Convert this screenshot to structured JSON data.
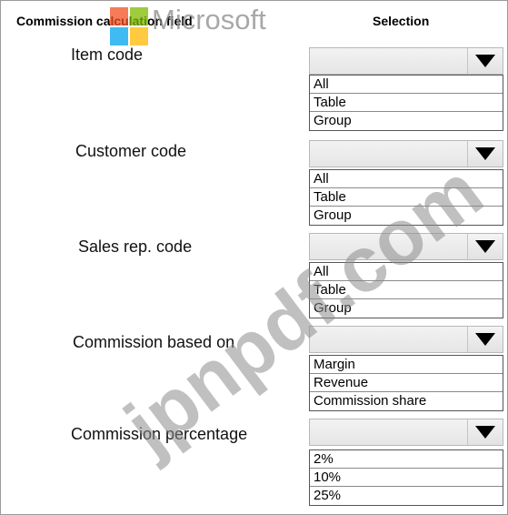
{
  "header": {
    "field_label": "Commission calculation field",
    "selection_label": "Selection"
  },
  "branding": {
    "ms_text": "Microsoft",
    "watermark": "jpnpdf.com",
    "logo_colors": [
      "#f25022",
      "#7fba00",
      "#00a4ef",
      "#ffb900"
    ]
  },
  "rows": [
    {
      "label": "Item code",
      "selected": "",
      "options": [
        "All",
        "Table",
        "Group"
      ]
    },
    {
      "label": "Customer code",
      "selected": "",
      "options": [
        "All",
        "Table",
        "Group"
      ]
    },
    {
      "label": "Sales rep. code",
      "selected": "",
      "options": [
        "All",
        "Table",
        "Group"
      ]
    },
    {
      "label": "Commission based on",
      "selected": "",
      "options": [
        "Margin",
        "Revenue",
        "Commission share"
      ]
    },
    {
      "label": "Commission percentage",
      "selected": "",
      "options": [
        "2%",
        "10%",
        "25%"
      ]
    }
  ]
}
